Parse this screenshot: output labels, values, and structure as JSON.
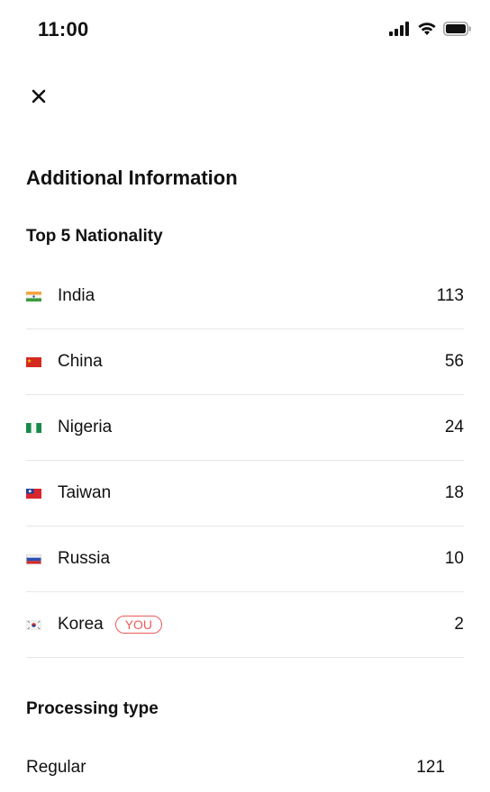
{
  "status_bar": {
    "time": "11:00",
    "icons": [
      "cellular-signal-icon",
      "wifi-icon",
      "battery-icon"
    ]
  },
  "header": {
    "close_icon": "close-icon"
  },
  "page": {
    "title": "Additional Information"
  },
  "nationality": {
    "title": "Top 5 Nationality",
    "items": [
      {
        "country": "India",
        "count": "113",
        "flag": "india-flag-icon"
      },
      {
        "country": "China",
        "count": "56",
        "flag": "china-flag-icon"
      },
      {
        "country": "Nigeria",
        "count": "24",
        "flag": "nigeria-flag-icon"
      },
      {
        "country": "Taiwan",
        "count": "18",
        "flag": "taiwan-flag-icon"
      },
      {
        "country": "Russia",
        "count": "10",
        "flag": "russia-flag-icon"
      },
      {
        "country": "Korea",
        "count": "2",
        "flag": "korea-flag-icon",
        "badge": "YOU"
      }
    ]
  },
  "processing": {
    "title": "Processing type",
    "items": [
      {
        "label": "Regular",
        "count": "121"
      }
    ]
  },
  "colors": {
    "accent": "#ec5a5a",
    "divider": "#e6e6e6",
    "text": "#111111"
  }
}
